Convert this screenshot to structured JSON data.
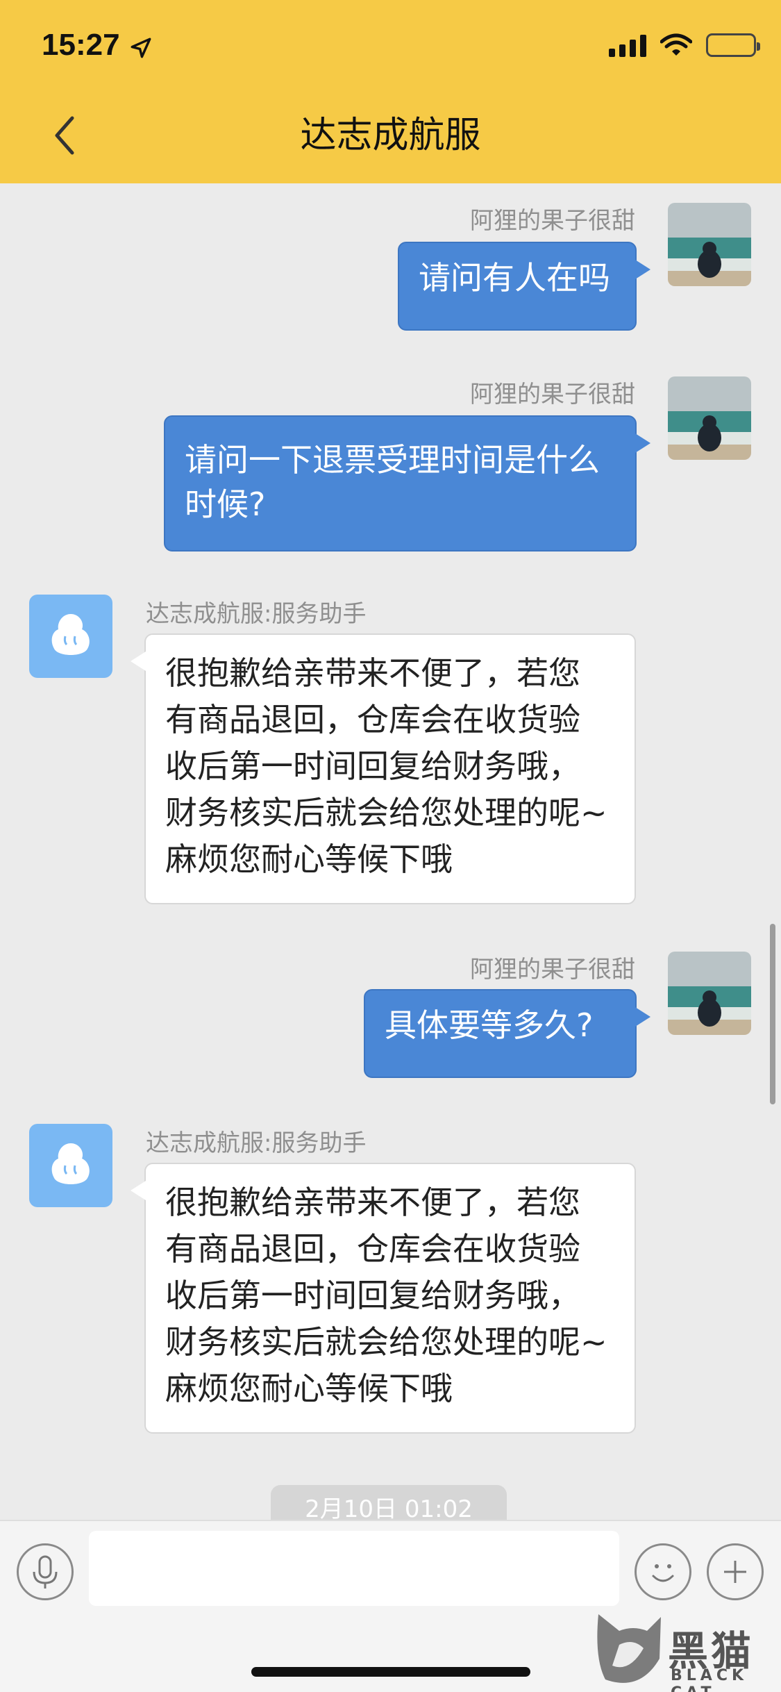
{
  "status_bar": {
    "time": "15:27"
  },
  "header": {
    "title": "达志成航服"
  },
  "colors": {
    "header_bg": "#f6ca46",
    "chat_bg": "#ebebeb",
    "user_bubble": "#4a87d6",
    "bot_bubble": "#ffffff",
    "bot_avatar": "#7ab8f3"
  },
  "messages": [
    {
      "side": "right",
      "sender": "阿狸的果子很甜",
      "text": "请问有人在吗"
    },
    {
      "side": "right",
      "sender": "阿狸的果子很甜",
      "lines": [
        "请问一下退票受理时间是什么",
        "时候?"
      ]
    },
    {
      "side": "left",
      "sender": "达志成航服:服务助手",
      "lines": [
        "很抱歉给亲带来不便了，若您",
        "有商品退回，仓库会在收货验",
        "收后第一时间回复给财务哦，",
        "财务核实后就会给您处理的呢~",
        "麻烦您耐心等候下哦"
      ]
    },
    {
      "side": "right",
      "sender": "阿狸的果子很甜",
      "text": "具体要等多久?"
    },
    {
      "side": "left",
      "sender": "达志成航服:服务助手",
      "lines": [
        "很抱歉给亲带来不便了，若您",
        "有商品退回，仓库会在收货验",
        "收后第一时间回复给财务哦，",
        "财务核实后就会给您处理的呢~",
        "麻烦您耐心等候下哦"
      ]
    }
  ],
  "timestamp": "2月10日 01:02",
  "input": {
    "placeholder": ""
  },
  "icons": {
    "back": "chevron-left-icon",
    "mic": "microphone-icon",
    "emoji": "smiley-icon",
    "plus": "plus-icon",
    "location": "location-arrow-icon",
    "signal": "signal-icon",
    "wifi": "wifi-icon",
    "battery": "battery-icon"
  },
  "watermark": {
    "title": "黑猫",
    "subtitle": "BLACK CAT"
  }
}
